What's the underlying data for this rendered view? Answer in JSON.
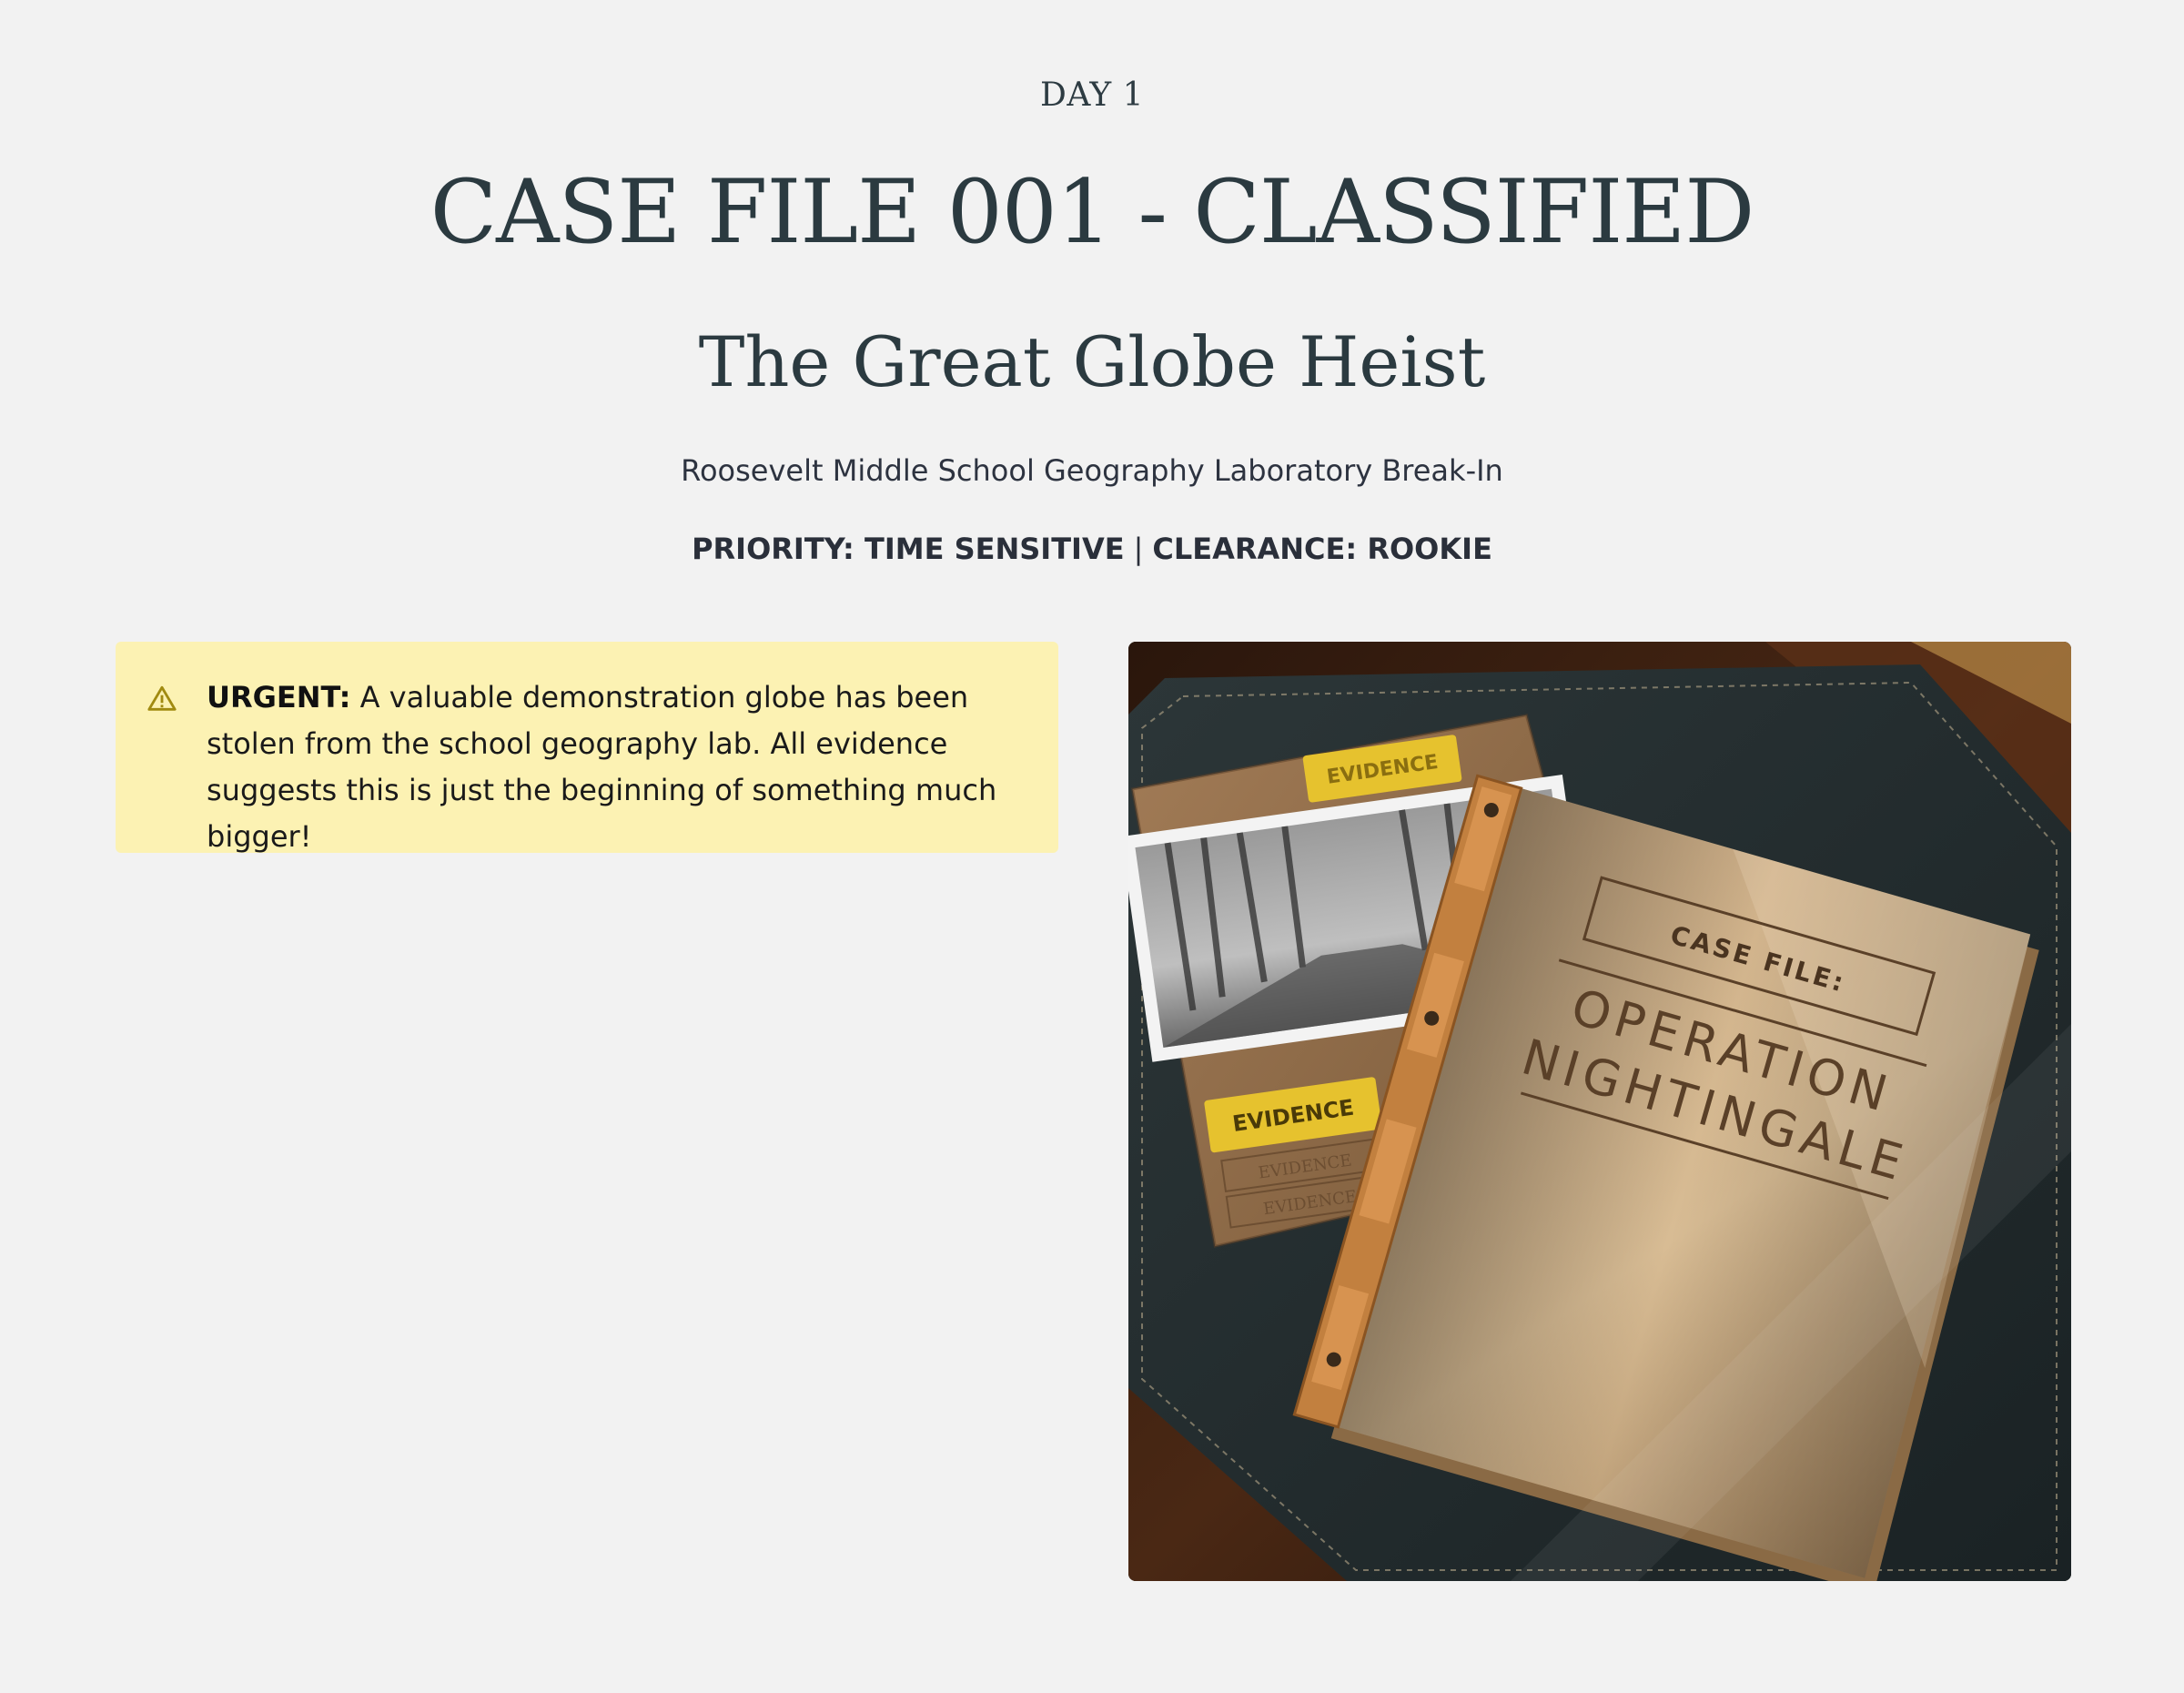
{
  "header": {
    "day": "DAY 1",
    "title": "CASE FILE 001 - CLASSIFIED",
    "subtitle": "The Great Globe Heist",
    "location": "Roosevelt Middle School Geography Laboratory Break-In",
    "priority": "PRIORITY: TIME SENSITIVE",
    "separator": "|",
    "clearance": "CLEARANCE: ROOKIE"
  },
  "alert": {
    "icon": "warning-icon",
    "label": "URGENT:",
    "message": "A valuable demonstration globe has been stolen from the school geography lab. All evidence suggests this is just the beginning of something much bigger!"
  },
  "photo": {
    "folder_label": "CASE FILE:",
    "folder_title_line1": "OPERATION",
    "folder_title_line2": "NIGHTINGALE",
    "evidence_tag_top": "EVIDENCE",
    "evidence_tag_bottom": "EVIDENCE",
    "evidence_stamp_1": "EVIDENCE",
    "evidence_stamp_2": "EVIDENCE"
  },
  "colors": {
    "background": "#f2f2f2",
    "heading": "#2b3a40",
    "alert_background": "#fcf2b3",
    "alert_icon": "#a08a10"
  }
}
